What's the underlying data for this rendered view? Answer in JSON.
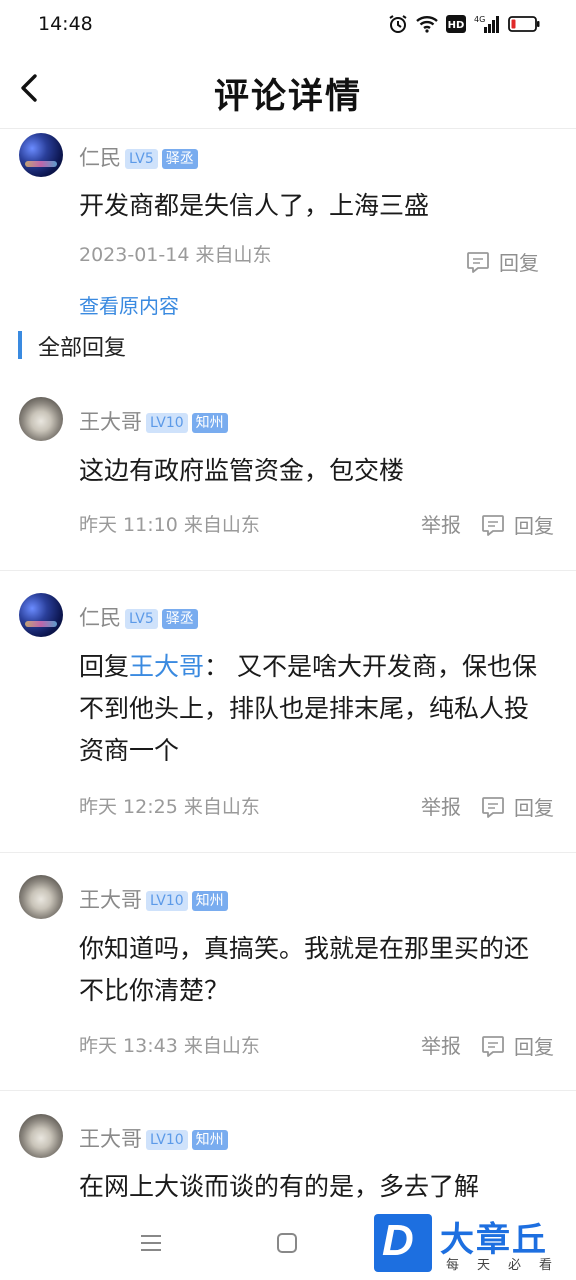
{
  "status": {
    "time": "14:48",
    "network": "4G"
  },
  "header": {
    "title": "评论详情"
  },
  "main_comment": {
    "username": "仁民",
    "level": "LV5",
    "location_tag": "驿丞",
    "text": "开发商都是失信人了，上海三盛",
    "meta": "2023-01-14 来自山东",
    "reply_label": "回复",
    "view_original": "查看原内容"
  },
  "section": {
    "title": "全部回复"
  },
  "replies": [
    {
      "username": "王大哥",
      "level": "LV10",
      "location_tag": "知州",
      "text": "这边有政府监管资金，包交楼",
      "meta": "昨天 11:10 来自山东",
      "report_label": "举报",
      "reply_label": "回复"
    },
    {
      "username": "仁民",
      "level": "LV5",
      "location_tag": "驿丞",
      "mention_prefix": "回复",
      "mention": "王大哥",
      "text": "： 又不是啥大开发商，保也保不到他头上，排队也是排末尾，纯私人投资商一个",
      "meta": "昨天 12:25 来自山东",
      "report_label": "举报",
      "reply_label": "回复"
    },
    {
      "username": "王大哥",
      "level": "LV10",
      "location_tag": "知州",
      "text": "你知道吗，真搞笑。我就是在那里买的还不比你清楚？",
      "meta": "昨天 13:43 来自山东",
      "report_label": "举报",
      "reply_label": "回复"
    },
    {
      "username": "王大哥",
      "level": "LV10",
      "location_tag": "知州",
      "text": "在网上大谈而谈的有的是，多去了解"
    }
  ],
  "watermark": {
    "logo_letter": "D",
    "title": "大章丘",
    "subtitle": "每天必看"
  },
  "colors": {
    "accent": "#3a8ae0",
    "badge_bg": "#79acef"
  }
}
